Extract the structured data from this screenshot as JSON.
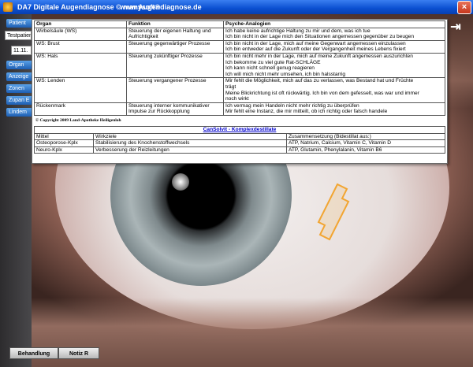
{
  "window": {
    "title_left": "DA7 Digitale Augendiagnose  © manysoft®",
    "title_right": "www.Augendiagnose.de",
    "close_label": "×"
  },
  "sidebar": {
    "items": [
      {
        "label": "Patient"
      },
      {
        "label": "Testpatien"
      },
      {
        "label": "11.11."
      },
      {
        "label": "Organ"
      },
      {
        "label": "Anzeige"
      },
      {
        "label": "Zonen"
      },
      {
        "label": "Zupan E"
      },
      {
        "label": "Lindem"
      }
    ]
  },
  "analysis_table": {
    "headers": [
      "Organ",
      "Funktion",
      "Psyche-Analogien"
    ],
    "rows": [
      {
        "organ": "Wirbelsäule (WS)",
        "funktion": [
          "Steuerung der eigenen Haltung und",
          "Aufrichtigkeit"
        ],
        "psyche": [
          "Ich habe keine aufrichtige Haltung zu mir und dem, was ich tue",
          "Ich bin nicht in der Lage mich den Situationen angemessen gegenüber zu beugen"
        ]
      },
      {
        "organ": "WS: Brust",
        "funktion": [
          "Steuerung gegenwärtiger Prozesse",
          ""
        ],
        "psyche": [
          "Ich bin nicht in der Lage, mich auf meine Gegenwart angemessen einzulassen",
          "Ich bin entweder auf die Zukunft oder der Vergangenheit meines Lebens fixiert"
        ]
      },
      {
        "organ": "WS: Hals",
        "funktion": [
          "Steuerung zukünftiger Prozesse",
          ""
        ],
        "psyche": [
          "Ich bin nicht mehr in der Lage, mich auf meine Zukunft angemessen auszurichten",
          "Ich bekomme zu viel gute Rat-SCHLÄGE",
          "Ich kann nicht schnell genug reagieren",
          "Ich will mich nicht mehr umsehen, ich bin halsstarrig"
        ]
      },
      {
        "organ": "WS: Lenden",
        "funktion": [
          "Steuerung vergangener Prozesse",
          ""
        ],
        "psyche": [
          "Mir fehlt die Möglichkeit, mich auf das zu verlassen, was Bestand hat und Früchte",
          "trägt",
          "Meine Blickrichtung ist oft rückwärtig. Ich bin von dem gefesselt, was war und immer",
          "noch wirkt"
        ]
      },
      {
        "organ": "Rückenmark",
        "funktion": [
          "Steuerung interner kommunikativer",
          "Impulse zur Rückkopplung"
        ],
        "psyche": [
          "Ich vermag mein Handeln nicht mehr richtig zu überprüfen",
          "Mir fehlt eine Instanz, die mir mitteilt, ob ich richtig oder falsch handele"
        ]
      }
    ]
  },
  "copyright": "© Copyright 2009 Land-Apotheke Heiligenloh",
  "cansolvit": {
    "title": "CanSolvit - Komplexdestillate",
    "headers": [
      "Mittel",
      "Wirkziele",
      "Zusammensetzung (Bidestillat aus:)"
    ],
    "rows": [
      [
        "Osteoporose-Kplx",
        "Stabilisierung des Knochenstoffwechsels",
        "ATP, Natrium, Calcium, Vitamin C, Vitamin D"
      ],
      [
        "Neuro-Kplx",
        "Verbesserung der Reizleitungen",
        "ATP, Glutamin, Phenylalanin, Vitamin B6"
      ]
    ]
  },
  "buttons": {
    "behandlung": "Behandlung",
    "notiz": "Notiz R"
  },
  "colors": {
    "titlebar": "#0a4fd0",
    "sidebar_button": "#1e5fb4",
    "link_blue": "#0000cc",
    "marker": "#f2a531"
  }
}
